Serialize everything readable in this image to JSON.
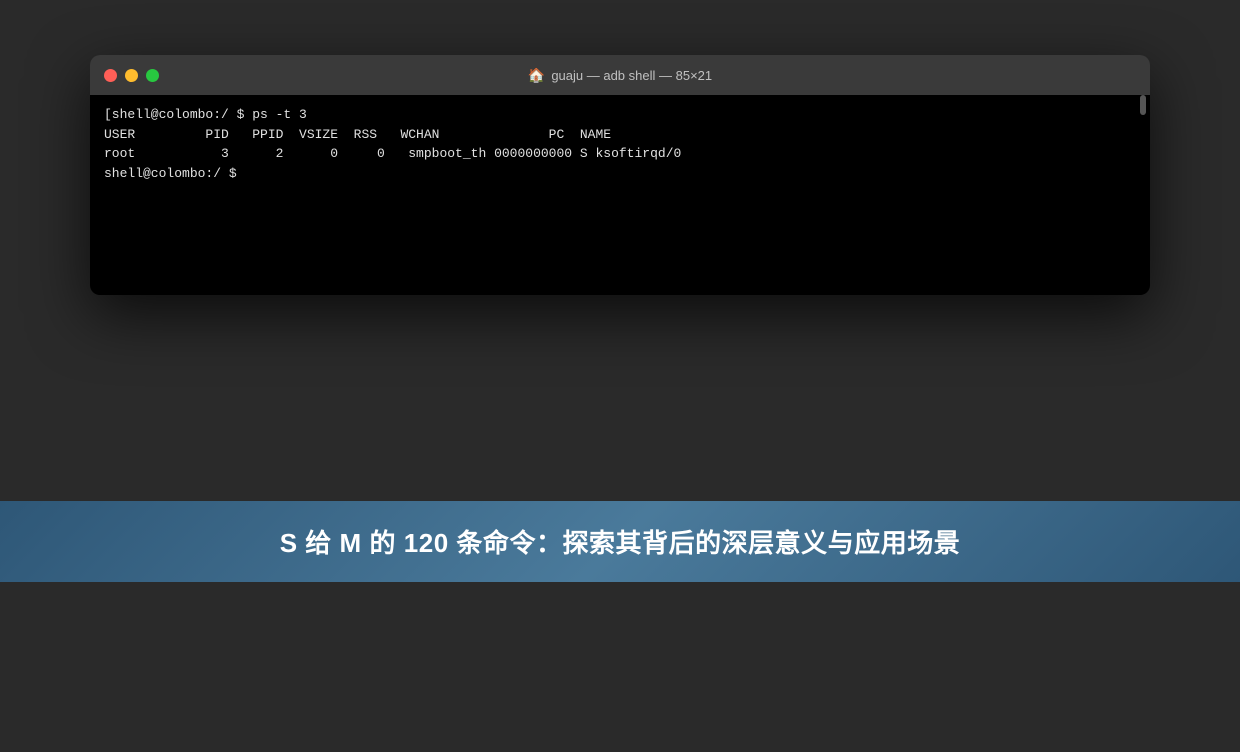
{
  "window": {
    "title_icon": "🏠",
    "title_text": "guaju — adb shell — 85×21",
    "scrollbar_visible": true
  },
  "traffic_lights": {
    "close_color": "#ff5f57",
    "minimize_color": "#febc2e",
    "maximize_color": "#28c840"
  },
  "terminal": {
    "lines": [
      "[shell@colombo:/ $ ps -t 3",
      "USER         PID   PPID  VSIZE  RSS   WCHAN              PC  NAME",
      "root           3      2      0     0   smpboot_th 0000000000 S ksoftirqd/0",
      "shell@colombo:/ $ "
    ]
  },
  "banner": {
    "text": "S 给 M 的 120 条命令：探索其背后的深层意义与应用场景"
  }
}
